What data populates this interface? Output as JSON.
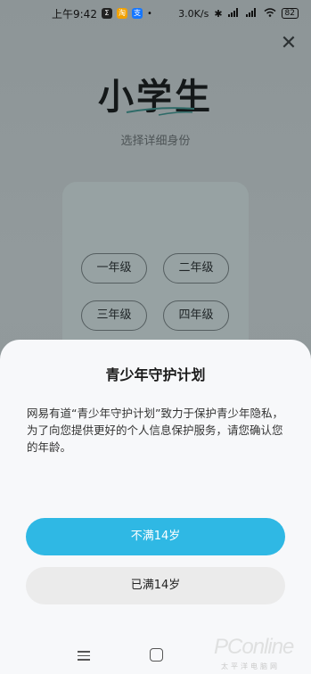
{
  "status_bar": {
    "time": "上午9:42",
    "apps": [
      "Σ",
      "淘",
      "支"
    ],
    "speed": "3.0K/s",
    "network": "4G",
    "battery": "82"
  },
  "background_page": {
    "title": "小学生",
    "subtitle": "选择详细身份",
    "grades": [
      "一年级",
      "二年级",
      "三年级",
      "四年级"
    ]
  },
  "sheet": {
    "title": "青少年守护计划",
    "body": "网易有道“青少年守护计划”致力于保护青少年隐私，为了向您提供更好的个人信息保护服务，请您确认您的年龄。",
    "under_14_label": "不满14岁",
    "over_14_label": "已满14岁"
  },
  "watermark": {
    "main": "PConline",
    "sub": "太平洋电脑网"
  },
  "colors": {
    "primary_button": "#2fb8e4",
    "secondary_button": "#ebebeb",
    "sheet_bg": "#f7f8fa"
  }
}
